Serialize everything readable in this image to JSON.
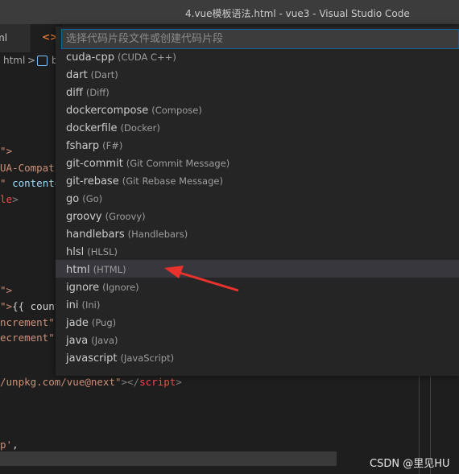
{
  "window": {
    "title": "4.vue模板语法.html - vue3 - Visual Studio Code"
  },
  "tabs": [
    {
      "label": "ml"
    },
    {
      "icon": "code-icon",
      "label": "<>"
    }
  ],
  "breadcrumb": {
    "file": "html",
    "separator": ">",
    "next": "b"
  },
  "editor": {
    "lines": [
      [
        {
          "t": "\">",
          "c": "c-str"
        }
      ],
      [
        {
          "t": "UA-Compati",
          "c": "c-str"
        }
      ],
      [
        {
          "t": "\" ",
          "c": "c-str"
        },
        {
          "t": "content=",
          "c": "c-attr"
        }
      ],
      [
        {
          "t": "le",
          "c": "c-tagred"
        },
        {
          "t": ">",
          "c": "c-punct"
        }
      ],
      [
        {
          "t": "\">",
          "c": "c-str"
        }
      ],
      [
        {
          "t": "\">",
          "c": "c-str"
        },
        {
          "t": "{{ count",
          "c": "c-txt"
        }
      ],
      [
        {
          "t": "ncrement\"",
          "c": "c-str"
        }
      ],
      [
        {
          "t": "ecrement\"",
          "c": "c-str"
        }
      ],
      [
        {
          "t": "/unpkg.com/vue@next\"",
          "c": "c-str"
        },
        {
          "t": "></",
          "c": "c-punct"
        },
        {
          "t": "script",
          "c": "c-tagred"
        },
        {
          "t": ">",
          "c": "c-punct"
        }
      ],
      [
        {
          "t": "p'",
          "c": "c-str"
        },
        {
          "t": ",",
          "c": "c-txt"
        }
      ]
    ]
  },
  "quickpick": {
    "placeholder": "选择代码片段文件或创建代码片段",
    "items": [
      {
        "name": "cuda-cpp",
        "desc": "(CUDA C++)"
      },
      {
        "name": "dart",
        "desc": "(Dart)"
      },
      {
        "name": "diff",
        "desc": "(Diff)"
      },
      {
        "name": "dockercompose",
        "desc": "(Compose)"
      },
      {
        "name": "dockerfile",
        "desc": "(Docker)"
      },
      {
        "name": "fsharp",
        "desc": "(F#)"
      },
      {
        "name": "git-commit",
        "desc": "(Git Commit Message)"
      },
      {
        "name": "git-rebase",
        "desc": "(Git Rebase Message)"
      },
      {
        "name": "go",
        "desc": "(Go)"
      },
      {
        "name": "groovy",
        "desc": "(Groovy)"
      },
      {
        "name": "handlebars",
        "desc": "(Handlebars)"
      },
      {
        "name": "hlsl",
        "desc": "(HLSL)"
      },
      {
        "name": "html",
        "desc": "(HTML)",
        "selected": true
      },
      {
        "name": "ignore",
        "desc": "(Ignore)"
      },
      {
        "name": "ini",
        "desc": "(Ini)"
      },
      {
        "name": "jade",
        "desc": "(Pug)"
      },
      {
        "name": "java",
        "desc": "(Java)"
      },
      {
        "name": "javascript",
        "desc": "(JavaScript)"
      }
    ]
  },
  "annotation": {
    "color": "#e8322b",
    "icon": "arrow-icon"
  },
  "watermark": "CSDN @里见HU"
}
